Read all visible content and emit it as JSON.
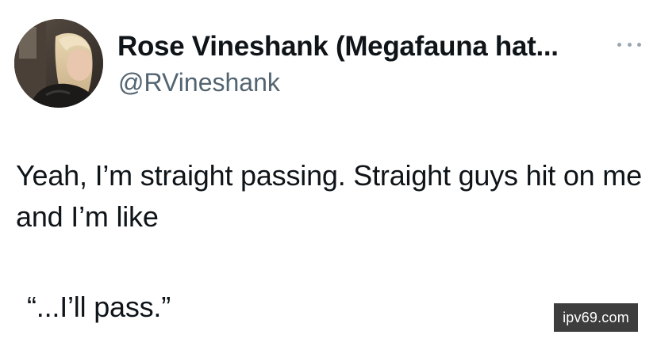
{
  "author": {
    "display_name": "Rose Vineshank (Megafauna hat...",
    "handle": "@RVineshank",
    "avatar_icon": "profile-photo"
  },
  "more_icon": "more-dots-icon",
  "tweet": {
    "line1": "Yeah, I’m straight passing. Straight guys hit on me and I’m like",
    "line2": "“...I’ll pass.”"
  },
  "watermark": {
    "text": "ipv69.com",
    "background": "#3d3d3d"
  },
  "colors": {
    "text_primary": "#0f1419",
    "text_secondary": "#536471"
  }
}
